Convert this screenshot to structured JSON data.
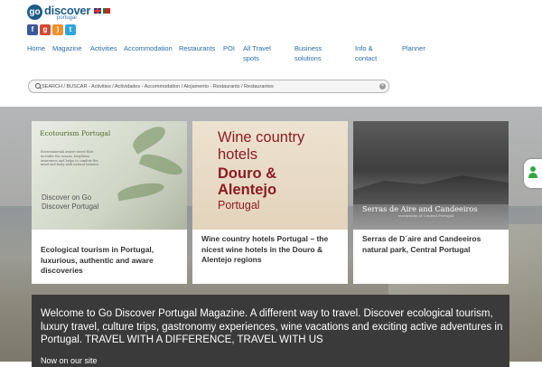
{
  "header": {
    "logo_word": "discover",
    "logo_sub": "portugal",
    "logo_go": "go"
  },
  "nav": {
    "items": [
      {
        "label": "Home"
      },
      {
        "label": "Magazine"
      },
      {
        "label": "Activities"
      },
      {
        "label": "Accommodation"
      },
      {
        "label": "Restaurants"
      },
      {
        "label": "POI"
      },
      {
        "label": "All Travel spots"
      },
      {
        "label": "Business solutions"
      },
      {
        "label": "Info & contact"
      },
      {
        "label": "Planner"
      }
    ]
  },
  "search": {
    "placeholder": "SEARCH / BUSCAR - Activities / Actividades - Accommodation / Alojamento - Restaurants / Restaurantes"
  },
  "cards": [
    {
      "title": "Ecological tourism in Portugal, luxurious, authentic and aware discoveries",
      "image_heading": "Ecotourism Portugal",
      "image_body": "Environmental aware travel that includes the senses, heightens awareness and helps to comfort the mind and body with natural balance.",
      "image_discover": "Discover on Go Discover Portugal"
    },
    {
      "title": "Wine country hotels Portugal – the nicest wine hotels in the Douro & Alentejo regions",
      "image_l1": "Wine country",
      "image_l2": "hotels",
      "image_l3": "Douro &",
      "image_l4": "Alentejo",
      "image_l5": "Portugal"
    },
    {
      "title": "Serras de D´aire and Candeeiros natural park, Central Portugal",
      "image_title": "Serras de Aire and Candeeiros",
      "image_sub": "mountains of Central Portugal"
    }
  ],
  "welcome": {
    "text": "Welcome to Go Discover Portugal Magazine. A different way to travel. Discover ecological tourism, luxury travel, culture trips, gastronomy experiences, wine vacations and exciting active adventures in Portugal. TRAVEL WITH A DIFFERENCE, TRAVEL WITH US",
    "tail": "Now on our site"
  },
  "icons": {
    "social": [
      "facebook-icon",
      "google-plus-icon",
      "rss-icon",
      "twitter-icon"
    ],
    "flags": [
      "uk-flag-icon",
      "portugal-flag-icon"
    ],
    "side": "user-icon"
  },
  "colors": {
    "brand": "#1d5a86",
    "nav_link": "#2a6ca8",
    "wine_red": "#8b1c24",
    "welcome_bg": "#3a3a3a"
  }
}
